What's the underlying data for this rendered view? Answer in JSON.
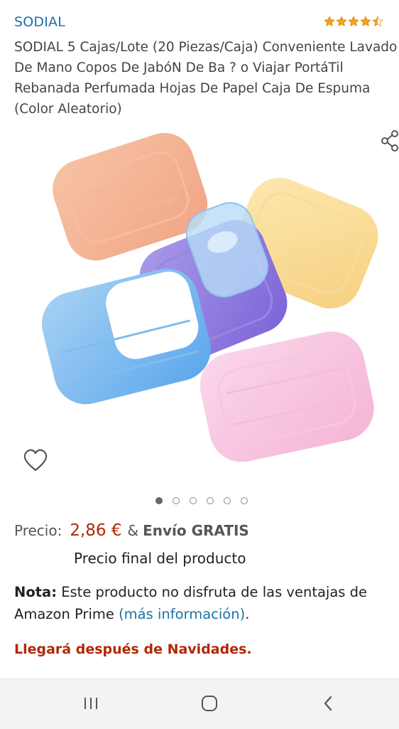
{
  "brand": "SODIAL",
  "rating": {
    "stars": 4.5,
    "max": 5
  },
  "title_lines": [
    "SODIAL 5 Cajas/Lote (20 Piezas/Caja) Conveniente Lavado",
    "De Mano Copos De JabóN De Ba ? o Viajar PortáTil",
    "Rebanada Perfumada Hojas De Papel Caja De Espuma",
    "(Color Aleatorio)"
  ],
  "image": {
    "count": 6,
    "active_index": 0
  },
  "price": {
    "label": "Precio:",
    "amount": "2,86 €",
    "amp": "&",
    "shipping": "Envío GRATIS",
    "final_note": "Precio final del producto"
  },
  "note": {
    "label": "Nota:",
    "text_line1": " Este producto no disfruta de las ventajas de",
    "text_line2": "Amazon Prime ",
    "link": "(más información)",
    "end": "."
  },
  "delivery": "Llegará después de Navidades.",
  "colors": {
    "accent": "#1a73a8",
    "price": "#b12704",
    "star": "#f4a41c"
  },
  "icons": {
    "share": "share-icon",
    "heart": "heart-icon",
    "recent": "recent-apps-icon",
    "home": "home-icon",
    "back": "back-icon"
  }
}
